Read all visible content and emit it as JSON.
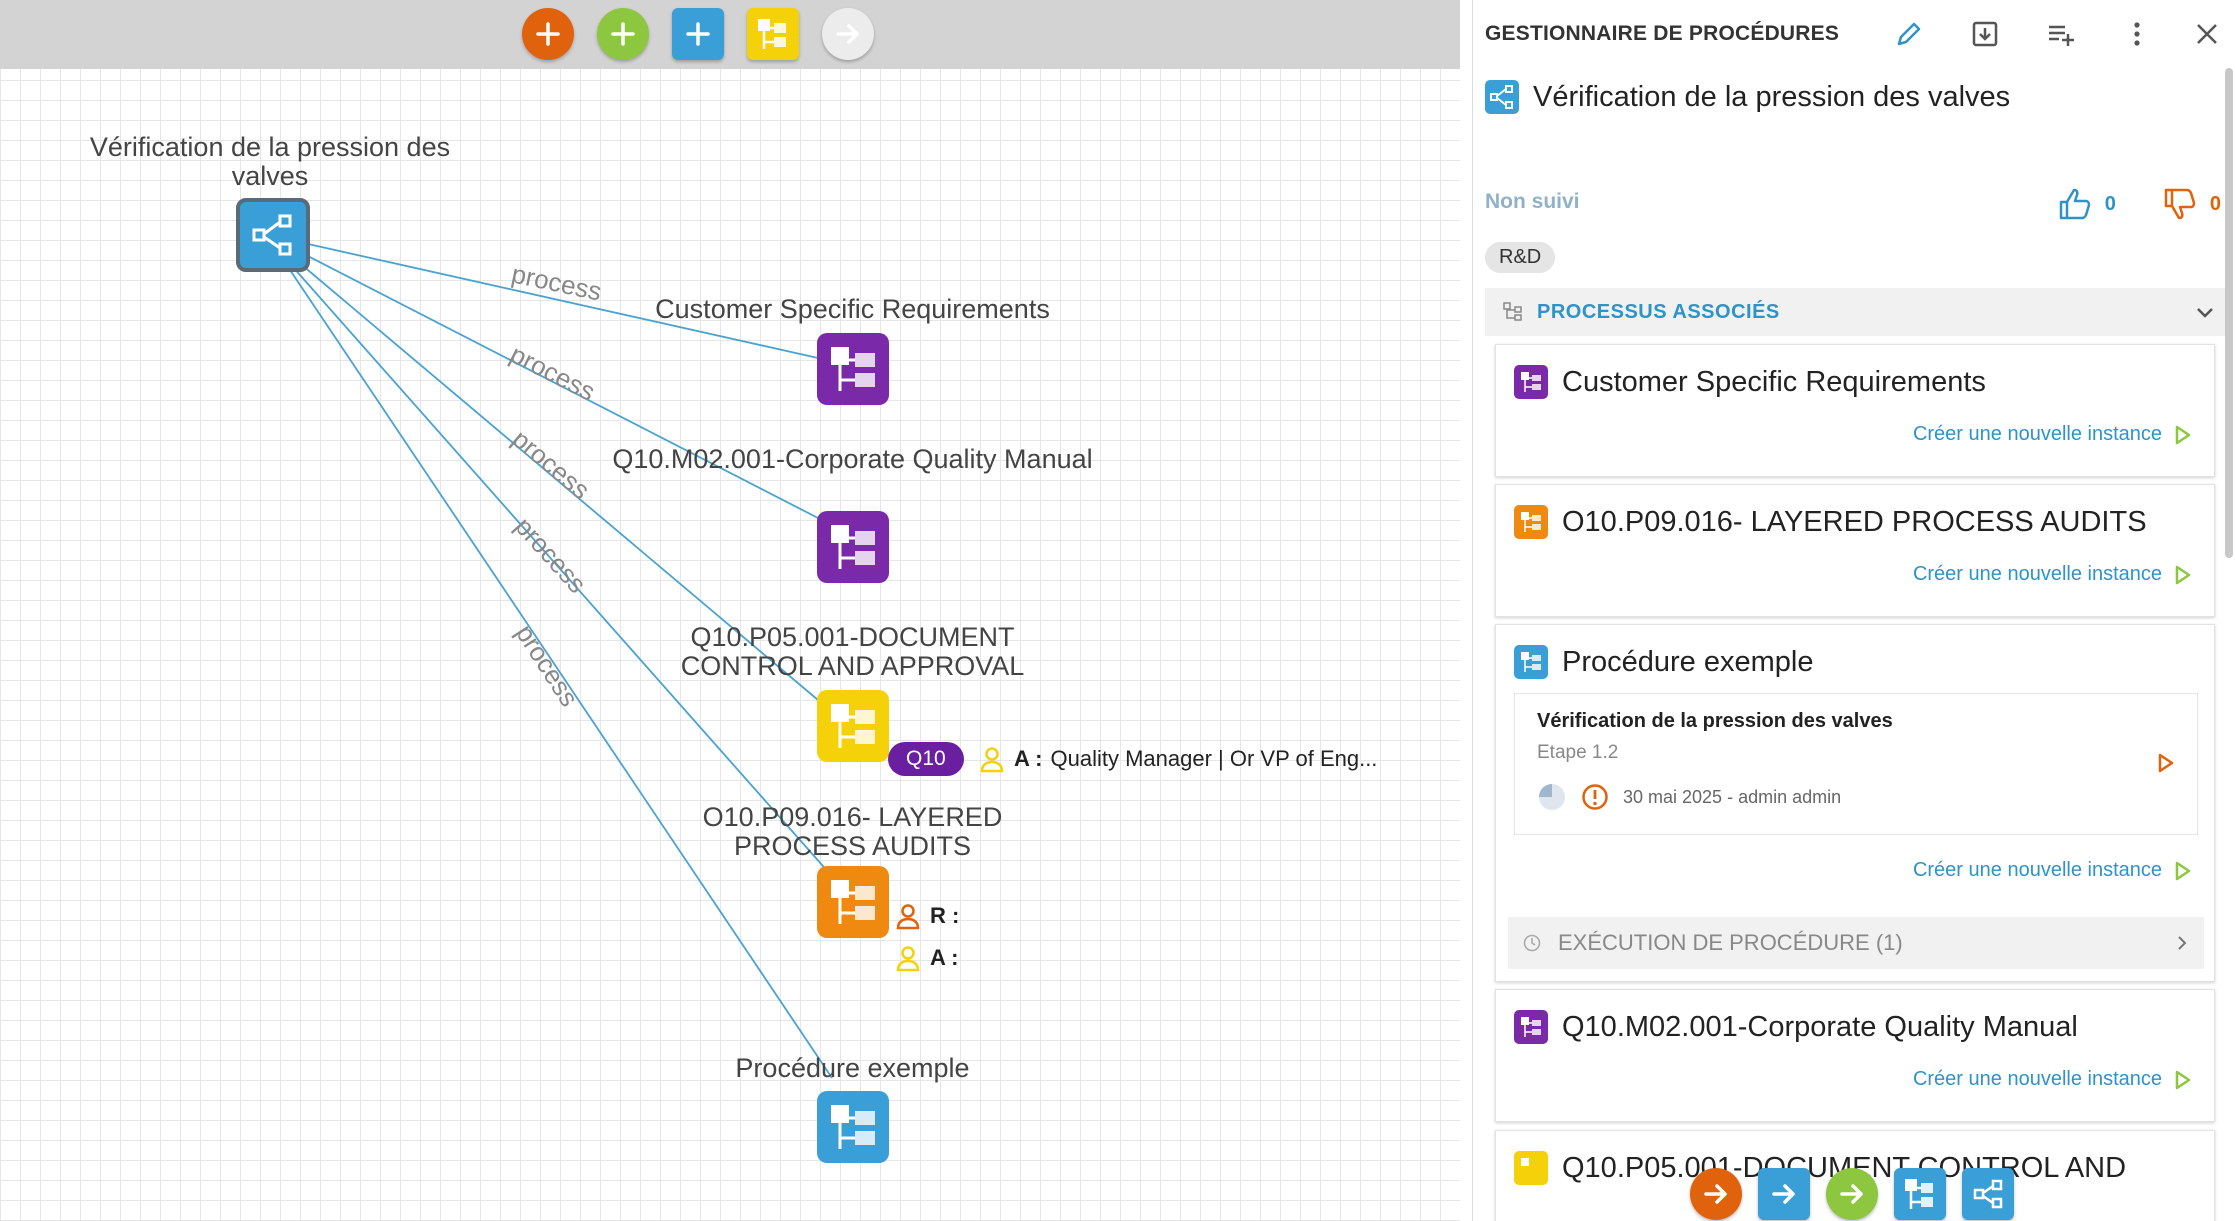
{
  "colors": {
    "orange": "#e0620c",
    "green": "#8dc63f",
    "blue": "#3a9fd6",
    "yellow": "#f5d10a",
    "gray_button": "#e6e6e6",
    "purple": "#7a2aa8",
    "amber": "#f0890f",
    "link": "#2f93c8",
    "edge": "#4aa3cf"
  },
  "toolbar": {
    "buttons": [
      {
        "name": "add-orange-button",
        "icon": "plus-icon"
      },
      {
        "name": "add-green-button",
        "icon": "plus-icon"
      },
      {
        "name": "add-blue-button",
        "icon": "plus-icon"
      },
      {
        "name": "add-process-button",
        "icon": "process-tree-icon"
      },
      {
        "name": "next-button",
        "icon": "arrow-right-icon"
      }
    ]
  },
  "graph": {
    "root": {
      "label": "Vérification de la pression des valves",
      "icon": "share-network-icon"
    },
    "edge_label": "process",
    "nodes": [
      {
        "label": "Customer Specific Requirements",
        "color": "purple",
        "icon": "process-tree-icon"
      },
      {
        "label": "Q10.M02.001-Corporate Quality Manual",
        "color": "purple",
        "icon": "process-tree-icon"
      },
      {
        "label": "Q10.P05.001-DOCUMENT CONTROL AND APPROVAL",
        "color": "yellow",
        "icon": "process-tree-icon",
        "badge": "Q10",
        "role": {
          "prefix": "A :",
          "text": "Quality Manager | Or VP of Eng..."
        }
      },
      {
        "label": "O10.P09.016-  LAYERED PROCESS AUDITS",
        "color": "amber",
        "icon": "process-tree-icon",
        "roles": [
          {
            "prefix": "R :"
          },
          {
            "prefix": "A :"
          }
        ]
      },
      {
        "label": "Procédure exemple",
        "color": "blue",
        "icon": "process-tree-icon"
      }
    ]
  },
  "panel": {
    "title": "GESTIONNAIRE DE PROCÉDURES",
    "header_icons": [
      "pencil-icon",
      "download-icon",
      "playlist-add-icon",
      "more-vert-icon",
      "close-icon"
    ],
    "procedure_title": "Vérification de la pression des valves",
    "status": "Non suivi",
    "likes": "0",
    "dislikes": "0",
    "tag": "R&D",
    "assoc_title": "PROCESSUS ASSOCIÉS",
    "create_instance": "Créer une nouvelle instance",
    "cards": [
      {
        "title": "Customer Specific Requirements",
        "color": "purple"
      },
      {
        "title": "O10.P09.016- LAYERED PROCESS AUDITS",
        "color": "amber"
      },
      {
        "title": "Procédure exemple",
        "color": "blue"
      },
      {
        "title": "Q10.M02.001-Corporate Quality Manual",
        "color": "purple"
      },
      {
        "title": "Q10.P05.001-DOCUMENT CONTROL AND",
        "color": "yellow"
      }
    ],
    "instance": {
      "title": "Vérification de la pression des valves",
      "step": "Etape 1.2",
      "meta": "30 mai 2025 - admin admin"
    },
    "exec_label": "EXÉCUTION DE PROCÉDURE (1)"
  },
  "bottom_bar": [
    "arrow-right-orange-button",
    "arrow-right-blue-button",
    "arrow-right-green-button",
    "process-tree-button",
    "share-network-button"
  ]
}
